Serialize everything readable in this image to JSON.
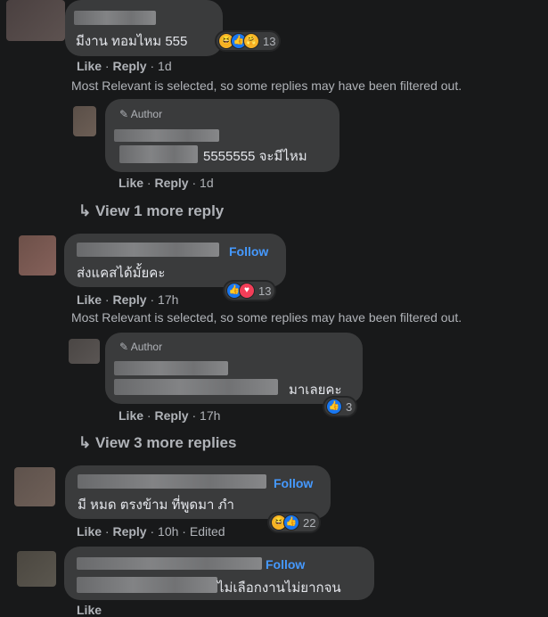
{
  "actions": {
    "like": "Like",
    "reply": "Reply",
    "follow": "Follow",
    "author": "Author",
    "edited": "Edited",
    "dot": "·"
  },
  "filter_notice": "Most Relevant is selected, so some replies may have been filtered out.",
  "comments": [
    {
      "text": "มีงาน ทอมไหม 555",
      "time": "1d",
      "reactions": [
        "haha-icon",
        "like-icon",
        "care-icon"
      ],
      "count": "13"
    },
    {
      "text": "ส่งแคสได้มั้ยคะ",
      "time": "17h",
      "reactions": [
        "like-icon",
        "heart-icon"
      ],
      "count": "13"
    },
    {
      "text": "มี หมด ตรงข้าม ที่พูดมา ภำ",
      "time": "10h",
      "reactions": [
        "haha-icon",
        "like-icon"
      ],
      "count": "22"
    },
    {
      "text": "ไม่เลือกงานไม่ยากจน",
      "time": ""
    }
  ],
  "replies": [
    {
      "text": "5555555 จะมีไหม",
      "time": "1d",
      "more": "View 1 more reply"
    },
    {
      "text": "มาเลยคะ",
      "time": "17h",
      "count": "3",
      "more": "View 3 more replies"
    }
  ],
  "colors": {
    "background": "#18191a",
    "bubble": "#3a3b3c",
    "link": "#4599ff",
    "like": "#1877f2",
    "heart": "#f33e58"
  }
}
